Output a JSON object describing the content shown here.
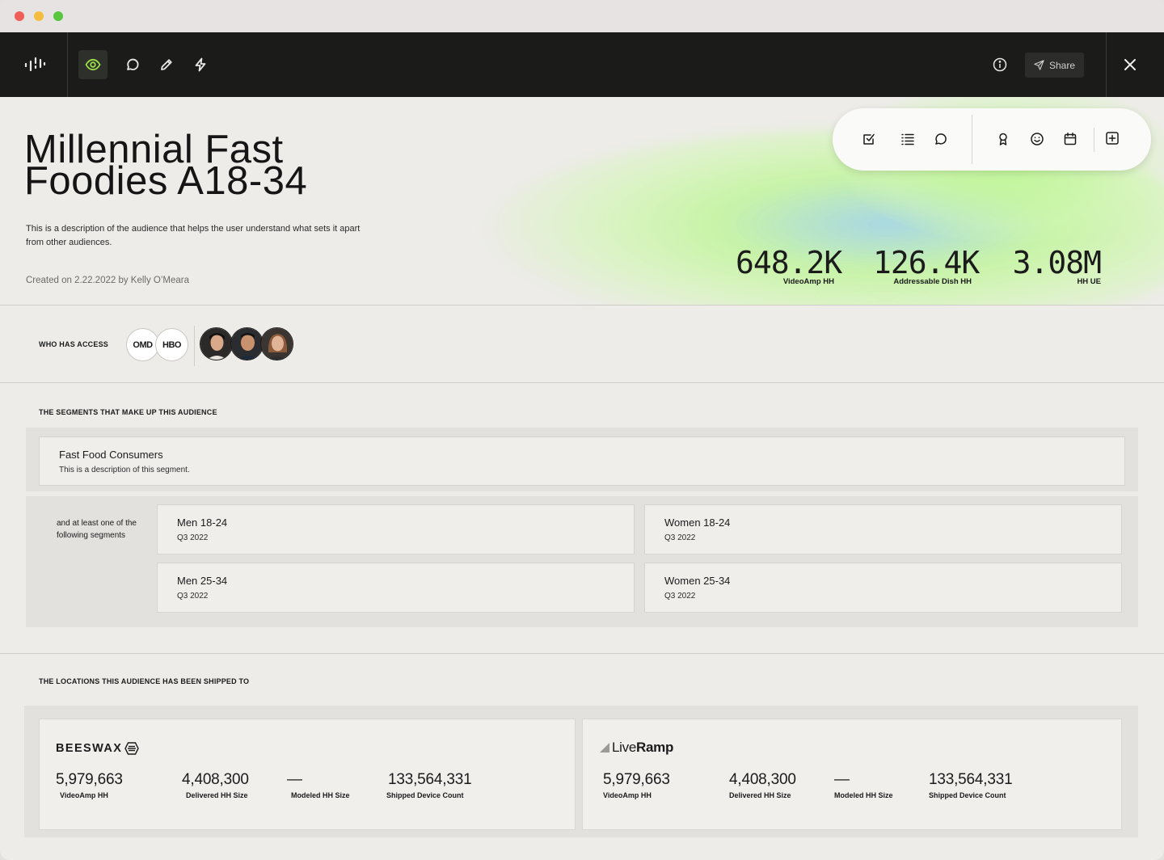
{
  "toolbar": {
    "share_label": "Share"
  },
  "audience": {
    "title": "Millennial Fast Foodies A18-34",
    "description": "This is a description of the audience that helps the user understand what sets it apart from other audiences.",
    "created": "Created on 2.22.2022 by Kelly O’Meara"
  },
  "stats": [
    {
      "value": "648.2K",
      "label": "VideoAmp HH"
    },
    {
      "value": "126.4K",
      "label": "Addressable Dish HH"
    },
    {
      "value": "3.08M",
      "label": "HH UE"
    }
  ],
  "access": {
    "label": "WHO HAS ACCESS",
    "orgs": [
      "OMD",
      "HBO"
    ]
  },
  "segments": {
    "label": "THE SEGMENTS THAT MAKE UP THIS AUDIENCE",
    "primary": {
      "name": "Fast Food Consumers",
      "description": "This is a description of this segment."
    },
    "or_text": "and at least one of the following segments",
    "options": [
      {
        "name": "Men 18-24",
        "period": "Q3 2022"
      },
      {
        "name": "Women 18-24",
        "period": "Q3 2022"
      },
      {
        "name": "Men 25-34",
        "period": "Q3 2022"
      },
      {
        "name": "Women 25-34",
        "period": "Q3 2022"
      }
    ]
  },
  "locations": {
    "label": "THE LOCATIONS THIS AUDIENCE HAS BEEN SHIPPED TO",
    "destinations": [
      {
        "name": "BEESWAX",
        "metrics": [
          {
            "value": "5,979,663",
            "label": "VideoAmp HH"
          },
          {
            "value": "4,408,300",
            "label": "Delivered HH Size"
          },
          {
            "value": "—",
            "label": "Modeled HH Size"
          },
          {
            "value": "133,564,331",
            "label": "Shipped Device Count"
          }
        ]
      },
      {
        "name_light": "Live",
        "name_bold": "Ramp",
        "metrics": [
          {
            "value": "5,979,663",
            "label": "VideoAmp HH"
          },
          {
            "value": "4,408,300",
            "label": "Delivered HH Size"
          },
          {
            "value": "—",
            "label": "Modeled HH Size"
          },
          {
            "value": "133,564,331",
            "label": "Shipped Device Count"
          }
        ]
      }
    ]
  },
  "colors": {
    "toolbar_bg": "#1b1c1a",
    "accent_green": "#9ee04a",
    "page_bg": "#edece8"
  }
}
